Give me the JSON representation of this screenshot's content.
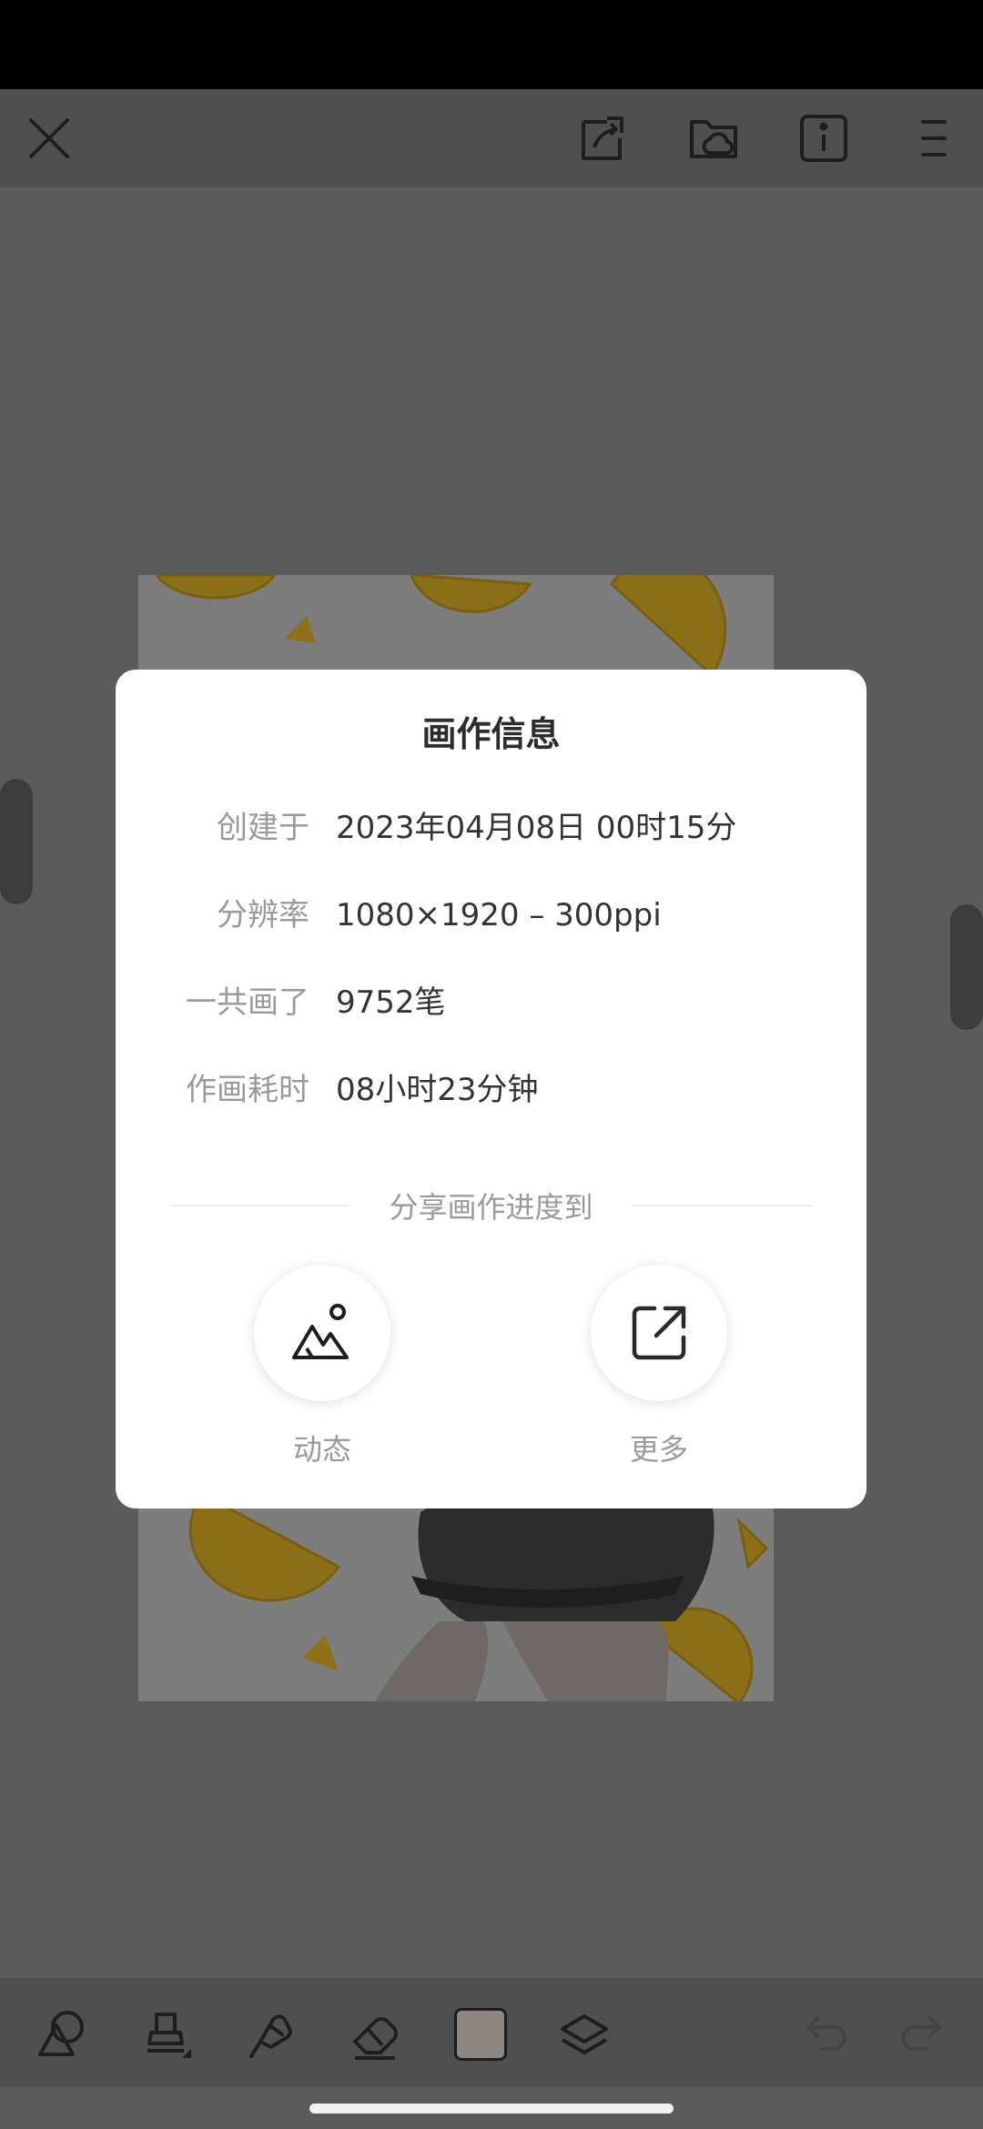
{
  "dialog": {
    "title": "画作信息",
    "rows": [
      {
        "label": "创建于",
        "value": "2023年04月08日 00时15分"
      },
      {
        "label": "分辨率",
        "value": "1080×1920 – 300ppi"
      },
      {
        "label": "一共画了",
        "value": "9752笔"
      },
      {
        "label": "作画耗时",
        "value": "08小时23分钟"
      }
    ],
    "share_heading": "分享画作进度到",
    "share_options": [
      {
        "label": "动态",
        "icon": "moments-icon"
      },
      {
        "label": "更多",
        "icon": "share-external-icon"
      }
    ]
  },
  "top_toolbar": {
    "icons": [
      "close-icon",
      "export-icon",
      "cloud-folder-icon",
      "info-icon",
      "menu-icon"
    ]
  },
  "bottom_toolbar": {
    "icons": [
      "shapes-icon",
      "brush-icon",
      "smudge-icon",
      "eraser-icon",
      "color-swatch",
      "layers-icon",
      "undo-icon",
      "redo-icon"
    ],
    "current_color": "#b9b0a8"
  }
}
